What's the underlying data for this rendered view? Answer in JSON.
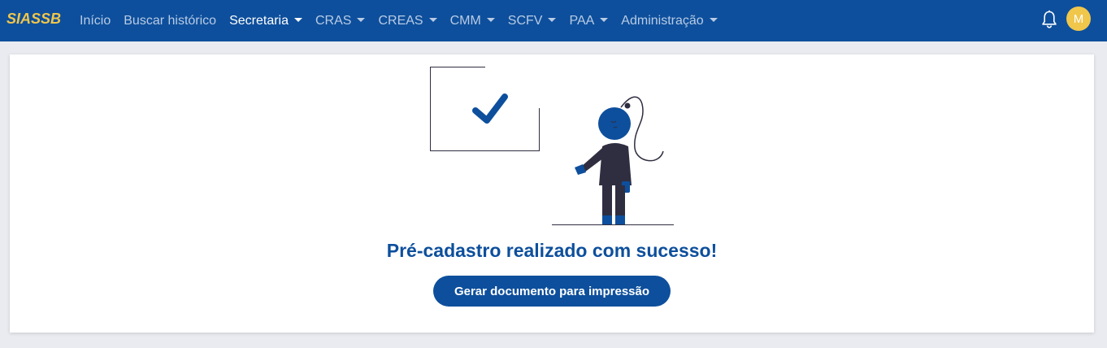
{
  "app": {
    "brand": "SIASSB"
  },
  "nav": {
    "items": [
      {
        "label": "Início",
        "dropdown": false,
        "active": false
      },
      {
        "label": "Buscar histórico",
        "dropdown": false,
        "active": false
      },
      {
        "label": "Secretaria",
        "dropdown": true,
        "active": true
      },
      {
        "label": "CRAS",
        "dropdown": true,
        "active": false
      },
      {
        "label": "CREAS",
        "dropdown": true,
        "active": false
      },
      {
        "label": "CMM",
        "dropdown": true,
        "active": false
      },
      {
        "label": "SCFV",
        "dropdown": true,
        "active": false
      },
      {
        "label": "PAA",
        "dropdown": true,
        "active": false
      },
      {
        "label": "Administração",
        "dropdown": true,
        "active": false
      }
    ],
    "notification_icon": "bell-icon",
    "user_avatar_initial": "M"
  },
  "main": {
    "illustration": "success-checkmark-person-illustration",
    "title": "Pré-cadastro realizado com sucesso!",
    "print_button_label": "Gerar documento para impressão"
  },
  "colors": {
    "primary": "#0d4f9c",
    "brand_accent": "#f0c64b",
    "nav_inactive_text": "#b9cbe4",
    "background": "#e9ebf0",
    "illustration_dark": "#2f2e41"
  }
}
